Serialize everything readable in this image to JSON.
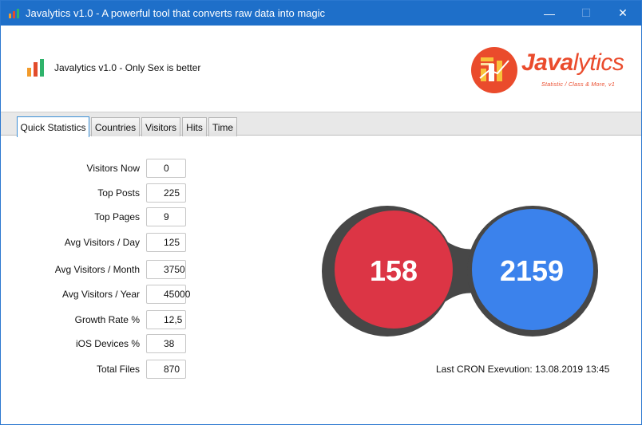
{
  "window": {
    "title": "Javalytics v1.0 - A powerful tool that converts raw data into magic",
    "controls": {
      "minimize": "—",
      "maximize": "☐",
      "close": "✕"
    }
  },
  "header": {
    "subtitle": "Javalytics v1.0 - Only Sex is better",
    "logo": {
      "word_java": "Java",
      "word_lytics": "lytics",
      "tagline": "Statistic / Class & More, v1"
    }
  },
  "tabs": [
    {
      "label": "Quick Statistics",
      "active": true
    },
    {
      "label": "Countries",
      "active": false
    },
    {
      "label": "Visitors",
      "active": false
    },
    {
      "label": "Hits",
      "active": false
    },
    {
      "label": "Time",
      "active": false
    }
  ],
  "stats": [
    {
      "label": "Visitors Now",
      "value": "0"
    },
    {
      "label": "Top Posts",
      "value": "225"
    },
    {
      "label": "Top Pages",
      "value": "9"
    },
    {
      "label": "Avg Visitors / Day",
      "value": "125"
    },
    {
      "label": "Avg Visitors / Month",
      "value": "3750"
    },
    {
      "label": "Avg Visitors / Year",
      "value": "45000"
    },
    {
      "label": "Growth Rate %",
      "value": "12,5"
    },
    {
      "label": "iOS Devices %",
      "value": "38"
    },
    {
      "label": "Total Files",
      "value": "870"
    }
  ],
  "circles": {
    "left": {
      "value": "158",
      "color": "#dc3545"
    },
    "right": {
      "value": "2159",
      "color": "#3b82ec"
    },
    "ring_color": "#474747"
  },
  "cron": {
    "text": "Last CRON Exevution: 13.08.2019 13:45"
  },
  "colors": {
    "titlebar": "#1e6fc9",
    "accent": "#ea4b2c",
    "tab_active_border": "#3b8ed6"
  }
}
